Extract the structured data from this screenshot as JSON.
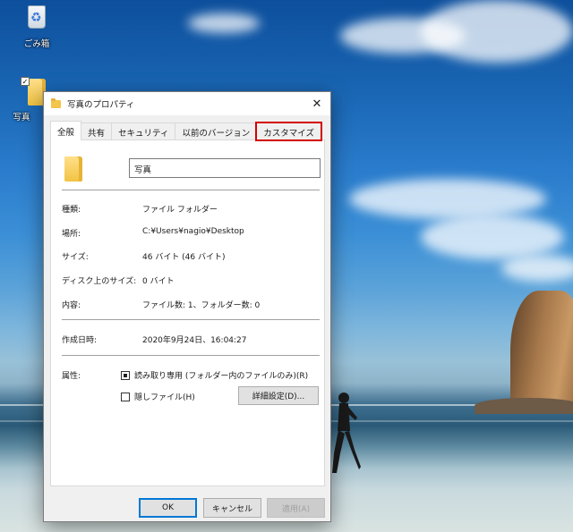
{
  "desktop": {
    "icons": [
      {
        "label": "ごみ箱"
      },
      {
        "label": "写真"
      }
    ]
  },
  "dialog": {
    "title": "写真のプロパティ",
    "close_glyph": "✕",
    "tabs": [
      {
        "label": "全般",
        "active": true
      },
      {
        "label": "共有"
      },
      {
        "label": "セキュリティ"
      },
      {
        "label": "以前のバージョン"
      },
      {
        "label": "カスタマイズ",
        "highlighted": true
      }
    ],
    "folder_name": "写真",
    "properties": [
      {
        "label": "種類:",
        "value": "ファイル フォルダー"
      },
      {
        "label": "場所:",
        "value": "C:¥Users¥nagio¥Desktop"
      },
      {
        "label": "サイズ:",
        "value": "46 バイト (46 バイト)"
      },
      {
        "label": "ディスク上のサイズ:",
        "value": "0 バイト"
      },
      {
        "label": "内容:",
        "value": "ファイル数: 1、フォルダー数: 0"
      }
    ],
    "created": {
      "label": "作成日時:",
      "value": "2020年9月24日、16:04:27"
    },
    "attributes": {
      "label": "属性:",
      "readonly": "読み取り専用 (フォルダー内のファイルのみ)(R)",
      "hidden": "隠しファイル(H)",
      "advanced_button": "詳細設定(D)..."
    },
    "buttons": {
      "ok": "OK",
      "cancel": "キャンセル",
      "apply": "適用(A)"
    }
  },
  "colors": {
    "highlight_outline": "#d40000",
    "primary_button_border": "#0078d7"
  }
}
